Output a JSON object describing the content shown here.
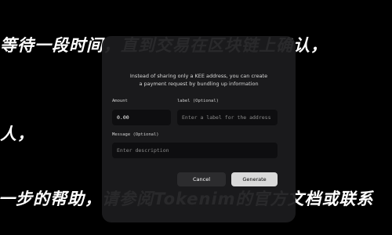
{
  "background_text": {
    "line1": "等待一段时间，直到交易在区块链上确认，",
    "line2": "人，",
    "line3": "一步的帮助，请参阅Tokenim的官方文档或联系"
  },
  "dialog": {
    "subtitle_line1": "Instead of sharing only a KEE address, you can create",
    "subtitle_line2": "a payment request by bundling up information",
    "amount_label": "Amount",
    "amount_value": "0.00",
    "label_label": "label (Optional)",
    "label_placeholder": "Enter a label for the address",
    "message_label": "Message (Optional)",
    "message_placeholder": "Enter description",
    "cancel_label": "Cancel",
    "generate_label": "Generate"
  },
  "colors": {
    "page_background": "#000000",
    "card_background": "#1c1c1e",
    "input_background": "#0e0e10",
    "primary_button": "#d9d9d9",
    "secondary_button": "#2c2c2e"
  }
}
